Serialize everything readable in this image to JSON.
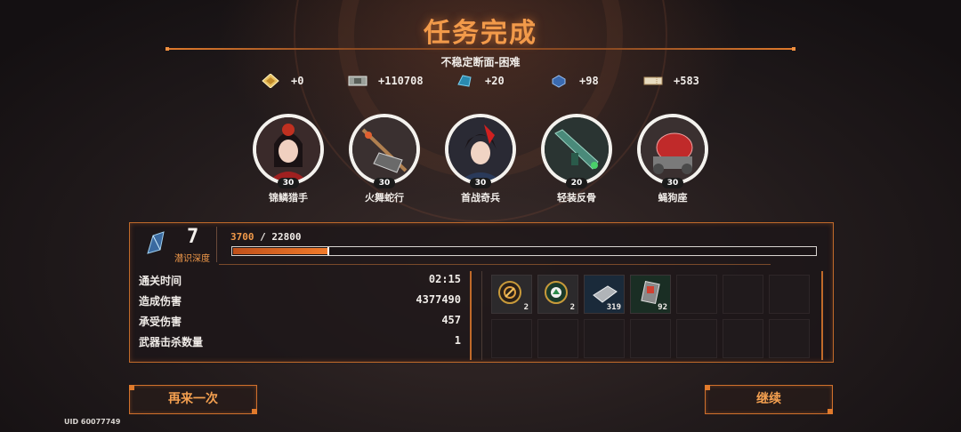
{
  "header": {
    "title": "任务完成",
    "subtitle": "不稳定断面-困难"
  },
  "rewards": [
    {
      "icon": "gold-diamond-icon",
      "value": "+0"
    },
    {
      "icon": "banknote-icon",
      "value": "+110708"
    },
    {
      "icon": "blue-crystal-icon",
      "value": "+20"
    },
    {
      "icon": "blue-chip-icon",
      "value": "+98"
    },
    {
      "icon": "ticket-icon",
      "value": "+583"
    }
  ],
  "characters": [
    {
      "name": "锦鳞猎手",
      "level": "30"
    },
    {
      "name": "火舞蛇行",
      "level": "30"
    },
    {
      "name": "首战奇兵",
      "level": "30"
    },
    {
      "name": "轻装反骨",
      "level": "20"
    },
    {
      "name": "蝇狗座",
      "level": "30"
    }
  ],
  "depth": {
    "value": "7",
    "label": "潜识深度"
  },
  "exp": {
    "current": "3700",
    "separator": " / ",
    "max": "22800",
    "progress": 0.162
  },
  "stats": [
    {
      "label": "通关时间",
      "value": "02:15"
    },
    {
      "label": "造成伤害",
      "value": "4377490"
    },
    {
      "label": "承受伤害",
      "value": "457"
    },
    {
      "label": "武器击杀数量",
      "value": "1"
    }
  ],
  "items": [
    {
      "icon": "orange-badge-icon",
      "qty": "2"
    },
    {
      "icon": "green-badge-icon",
      "qty": "2"
    },
    {
      "icon": "silver-plate-icon",
      "qty": "319"
    },
    {
      "icon": "green-card-icon",
      "qty": "92"
    }
  ],
  "buttons": {
    "retry": "再来一次",
    "continue": "继续"
  },
  "uid": "UID 60077749",
  "colors": {
    "accent": "#f29a4a",
    "border": "#c06a2a",
    "exp_fill": "#f07a2a"
  }
}
